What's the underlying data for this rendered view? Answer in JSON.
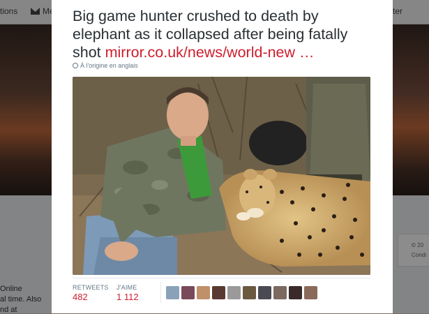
{
  "background": {
    "nav_left": "tions",
    "nav_messages": "Me",
    "nav_right": "ter",
    "left_text": [
      "Online",
      "al time. Also",
      "nd at"
    ],
    "right_text": [
      "© 20",
      "Condi"
    ]
  },
  "tweet": {
    "text": "Big game hunter crushed to death by elephant as it collapsed after being fatally shot",
    "link_text": "mirror.co.uk/news/world-new …",
    "translate_label": "À l'origine en anglais",
    "retweets_label": "RETWEETS",
    "retweets_count": "482",
    "likes_label": "J'AIME",
    "likes_count": "1 112"
  },
  "avatars": [
    {
      "name": "avatar-1",
      "color": "#8aa2b8"
    },
    {
      "name": "avatar-2",
      "color": "#7a4a5a"
    },
    {
      "name": "avatar-3",
      "color": "#c0906a"
    },
    {
      "name": "avatar-4",
      "color": "#5a3a30"
    },
    {
      "name": "avatar-5",
      "color": "#9a9a9a"
    },
    {
      "name": "avatar-6",
      "color": "#6a5a40"
    },
    {
      "name": "avatar-7",
      "color": "#4a4a52"
    },
    {
      "name": "avatar-8",
      "color": "#7a6a60"
    },
    {
      "name": "avatar-9",
      "color": "#3a2a2a"
    },
    {
      "name": "avatar-10",
      "color": "#8a6a5a"
    }
  ],
  "colors": {
    "link": "#cc1e2d",
    "stat_value": "#cc1e2d",
    "muted": "#657786"
  }
}
